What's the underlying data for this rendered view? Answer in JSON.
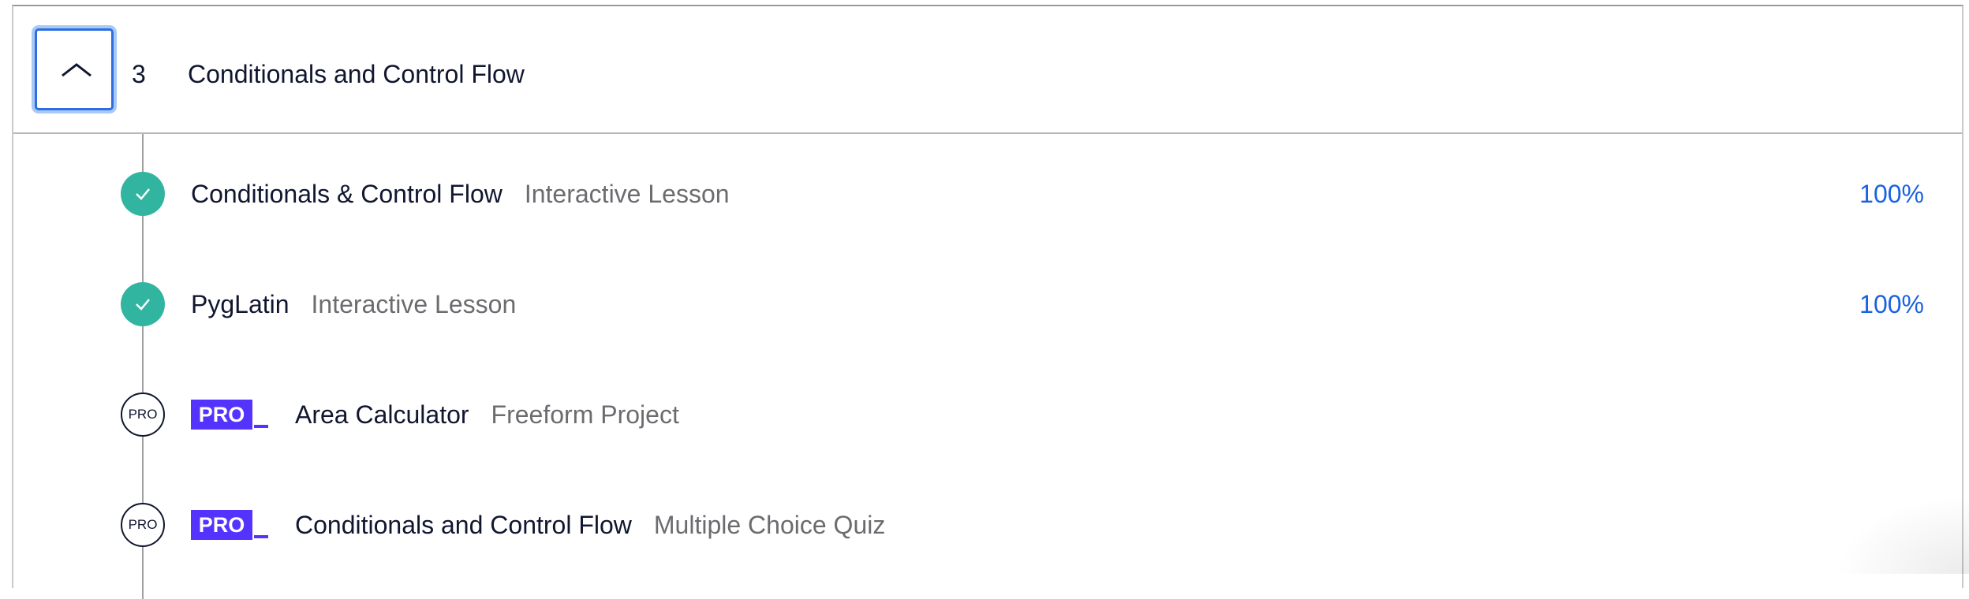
{
  "module": {
    "number": "3",
    "title": "Conditionals and Control Flow",
    "toggle_icon": "chevron-up-icon"
  },
  "items": [
    {
      "status": "completed",
      "status_icon": "check-icon",
      "pro": false,
      "title": "Conditionals & Control Flow",
      "type": "Interactive Lesson",
      "progress": "100%"
    },
    {
      "status": "completed",
      "status_icon": "check-icon",
      "pro": false,
      "title": "PygLatin",
      "type": "Interactive Lesson",
      "progress": "100%"
    },
    {
      "status": "pro",
      "status_label": "PRO",
      "pro": true,
      "pro_badge": "PRO",
      "title": "Area Calculator",
      "type": "Freeform Project"
    },
    {
      "status": "pro",
      "status_label": "PRO",
      "pro": true,
      "pro_badge": "PRO",
      "title": "Conditionals and Control Flow",
      "type": "Multiple Choice Quiz"
    }
  ],
  "colors": {
    "completed": "#31b5a1",
    "pro_badge": "#5533ff",
    "progress_text": "#1a62e0",
    "focus_ring": "#2b6fe0"
  }
}
